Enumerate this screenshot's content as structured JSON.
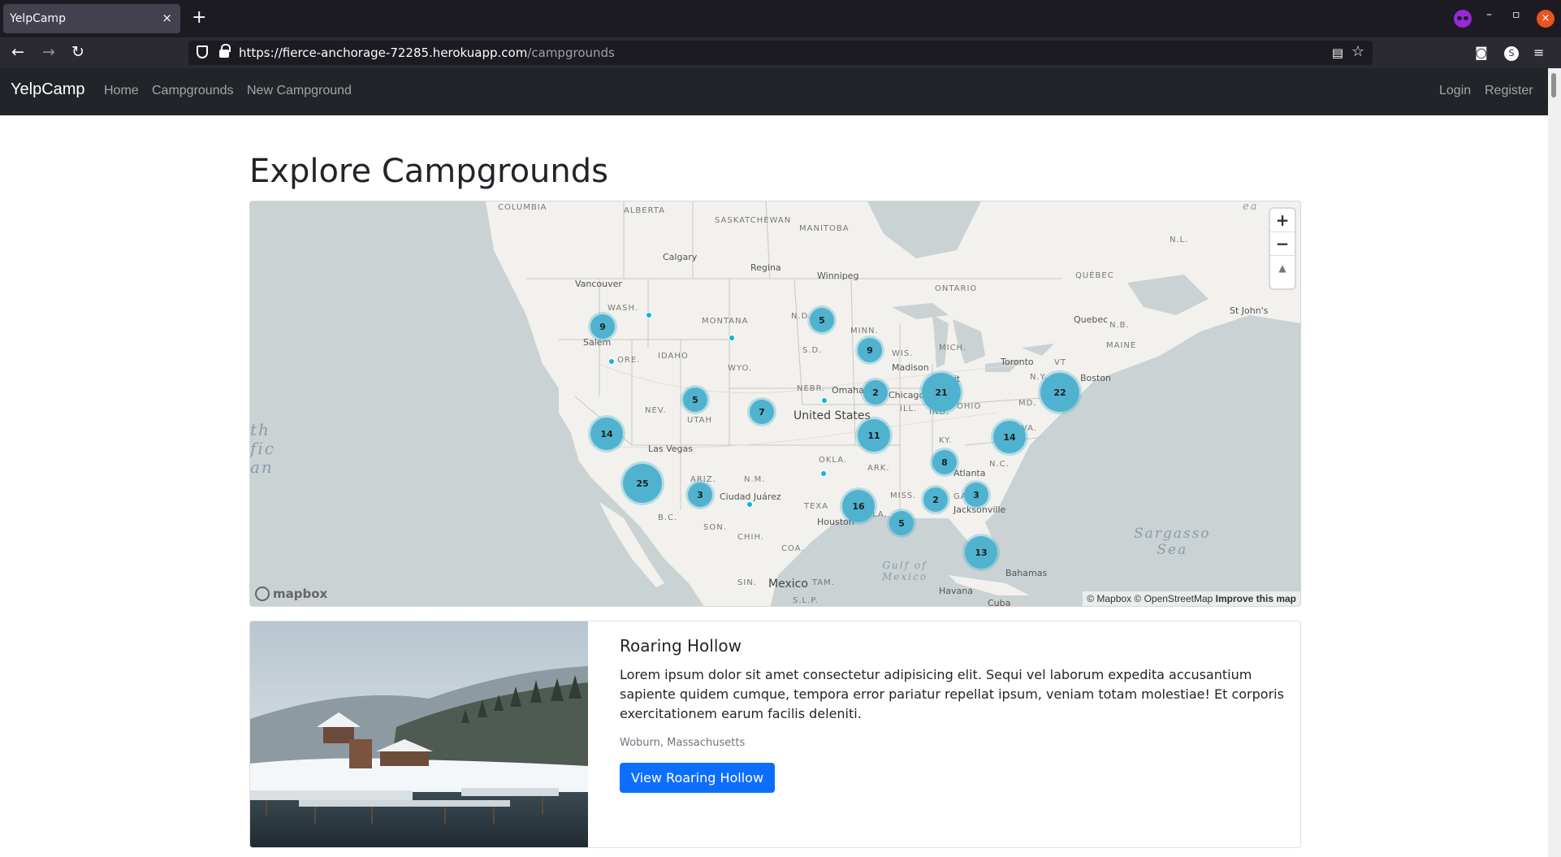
{
  "browser": {
    "tab_title": "YelpCamp",
    "tab_close": "×",
    "new_tab": "+",
    "url_host": "https://fierce-anchorage-72285.herokuapp.com",
    "url_path": "/campgrounds",
    "account_initial": "S"
  },
  "nav": {
    "brand": "YelpCamp",
    "home": "Home",
    "campgrounds": "Campgrounds",
    "new_campground": "New Campground",
    "login": "Login",
    "register": "Register"
  },
  "page": {
    "title": "Explore Campgrounds"
  },
  "map": {
    "zoom_in": "+",
    "zoom_out": "−",
    "compass": "▲",
    "logo": "mapbox",
    "attribution_1": "© Mapbox © OpenStreetMap",
    "attribution_2": "Improve this map",
    "region_labels": {
      "columbia": "COLUMBIA",
      "alberta": "ALBERTA",
      "saskatchewan": "SASKATCHEWAN",
      "manitoba": "MANITOBA",
      "ontario": "ONTARIO",
      "quebec": "QUÉBEC",
      "nl": "N.L.",
      "nb": "N.B.",
      "wash": "WASH.",
      "montana": "MONTANA",
      "nd": "N.D.",
      "minn": "MINN.",
      "mich": "MICH.",
      "idaho": "IDAHO",
      "wyo": "WYO.",
      "sd": "S.D.",
      "wis": "WIS.",
      "ore": "ORE.",
      "nebr": "NEBR.",
      "nev": "NEV.",
      "utah": "UTAH",
      "ill": "ILL.",
      "ind": "IND.",
      "ohio": "OHIO",
      "wva": "W.VA.",
      "ky": "KY.",
      "ariz": "ARIZ.",
      "nm": "N.M.",
      "okla": "OKLA.",
      "ark": "ARK.",
      "nc": "N.C.",
      "ga": "GA.",
      "miss": "MISS.",
      "la": "LA.",
      "texas": "TEXA",
      "son": "SON.",
      "chih": "CHIH.",
      "coa": "COA.",
      "bc": "B.C.",
      "sin": "SIN.",
      "slp": "S.L.P.",
      "tam": "TAM.",
      "maine": "MAINE",
      "vt": "VT",
      "ny": "N.Y.",
      "md": "MD."
    },
    "cities": {
      "calgary": "Calgary",
      "regina": "Regina",
      "winnipeg": "Winnipeg",
      "vancouver": "Vancouver",
      "quebec": "Quebec",
      "stjohns": "St John's",
      "salem": "Salem",
      "madison": "Madison",
      "toronto": "Toronto",
      "boston": "Boston",
      "omaha": "Omaha",
      "chicago": "Chicago",
      "detroit": "oit",
      "lasvegas": "Las Vegas",
      "atlanta": "Atlanta",
      "ciudadjuarez": "Ciudad Juárez",
      "jacksonville": "Jacksonville",
      "houston": "Houston",
      "bahamas": "Bahamas",
      "havana": "Havana",
      "cuba": "Cuba"
    },
    "countries": {
      "united_states": "United States",
      "mexico": "Mexico"
    },
    "waters": {
      "pacific": "th\nfic\nan",
      "sargasso": "Sargasso\nSea",
      "gulf": "Gulf of\nMexico",
      "ea": "ea"
    },
    "clusters": [
      {
        "count": "9"
      },
      {
        "count": "5"
      },
      {
        "count": "9"
      },
      {
        "count": "5"
      },
      {
        "count": "2"
      },
      {
        "count": "21"
      },
      {
        "count": "22"
      },
      {
        "count": "7"
      },
      {
        "count": "14"
      },
      {
        "count": "11"
      },
      {
        "count": "14"
      },
      {
        "count": "8"
      },
      {
        "count": "25"
      },
      {
        "count": "3"
      },
      {
        "count": "16"
      },
      {
        "count": "2"
      },
      {
        "count": "3"
      },
      {
        "count": "5"
      },
      {
        "count": "13"
      }
    ]
  },
  "card": {
    "title": "Roaring Hollow",
    "text": "Lorem ipsum dolor sit amet consectetur adipisicing elit. Sequi vel laborum expedita accusantium sapiente quidem cumque, tempora error pariatur repellat ipsum, veniam totam molestiae! Et corporis exercitationem earum facilis deleniti.",
    "location": "Woburn, Massachusetts",
    "button": "View Roaring Hollow"
  }
}
